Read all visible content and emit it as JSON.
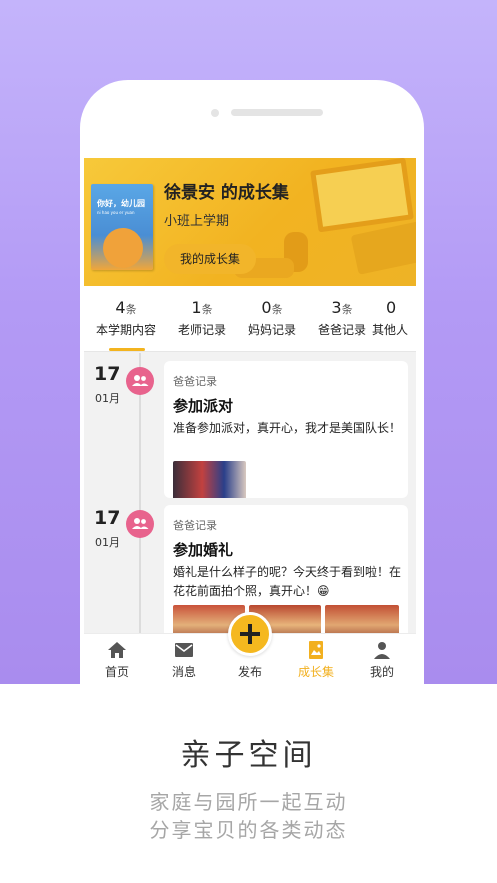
{
  "banner": {
    "book_title": "你好，幼儿园",
    "book_subtitle": "ni hao you er yuan",
    "child_title": "徐景安 的成长集",
    "term": "小班上学期",
    "button_label": "我的成长集"
  },
  "stats": [
    {
      "num": "4",
      "unit": "条",
      "label": "本学期内容"
    },
    {
      "num": "1",
      "unit": "条",
      "label": "老师记录"
    },
    {
      "num": "0",
      "unit": "条",
      "label": "妈妈记录"
    },
    {
      "num": "3",
      "unit": "条",
      "label": "爸爸记录"
    },
    {
      "num": "0",
      "unit": "",
      "label": "其他人"
    }
  ],
  "timeline": [
    {
      "day": "17",
      "month": "01月",
      "type": "爸爸记录",
      "title": "参加派对",
      "text": "准备参加派对，真开心，我才是美国队长！"
    },
    {
      "day": "17",
      "month": "01月",
      "type": "爸爸记录",
      "title": "参加婚礼",
      "text": "婚礼是什么样子的呢？今天终于看到啦！在花花前面拍个照，真开心！😁"
    }
  ],
  "tabbar": {
    "items": [
      {
        "label": "首页",
        "icon": "home-icon"
      },
      {
        "label": "消息",
        "icon": "mail-icon"
      },
      {
        "label": "发布",
        "icon": "plus-icon"
      },
      {
        "label": "成长集",
        "icon": "album-icon"
      },
      {
        "label": "我的",
        "icon": "person-icon"
      }
    ],
    "active": "成长集"
  },
  "caption": {
    "title": "亲子空间",
    "line1": "家庭与园所一起互动",
    "line2": "分享宝贝的各类动态"
  },
  "colors": {
    "accent": "#f3b41f",
    "background_top": "#b9a4f7",
    "avatar": "#e8638d"
  }
}
